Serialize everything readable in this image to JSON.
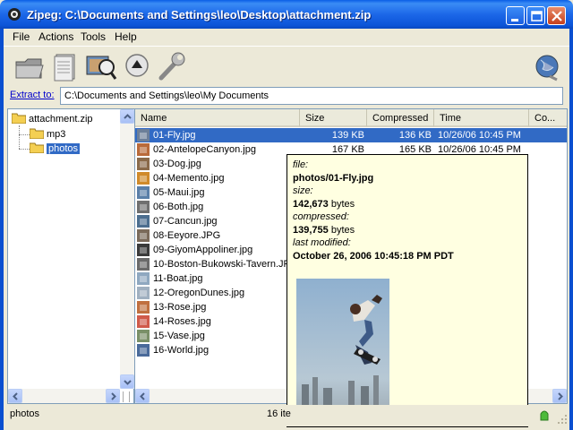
{
  "window": {
    "title": "Zipeg: C:\\Documents and Settings\\leo\\Desktop\\attachment.zip"
  },
  "menu": {
    "file": "File",
    "actions": "Actions",
    "tools": "Tools",
    "help": "Help"
  },
  "toolbar": {
    "icons": [
      "open-folder-icon",
      "document-stack-icon",
      "preview-icon",
      "eject-icon",
      "wrench-icon",
      "world-icon"
    ]
  },
  "extract": {
    "label": "Extract to:",
    "path": "C:\\Documents and Settings\\leo\\My Documents"
  },
  "tree": {
    "root": "attachment.zip",
    "children": [
      "mp3",
      "photos"
    ],
    "selected": "photos"
  },
  "columns": {
    "name": "Name",
    "size": "Size",
    "compressed": "Compressed",
    "time": "Time",
    "comment": "Co..."
  },
  "files": [
    {
      "name": "01-Fly.jpg",
      "size": "139 KB",
      "compressed": "136 KB",
      "time": "10/26/06 10:45 PM",
      "selected": true
    },
    {
      "name": "02-AntelopeCanyon.jpg",
      "size": "167 KB",
      "compressed": "165 KB",
      "time": "10/26/06 10:45 PM"
    },
    {
      "name": "03-Dog.jpg"
    },
    {
      "name": "04-Memento.jpg"
    },
    {
      "name": "05-Maui.jpg"
    },
    {
      "name": "06-Both.jpg"
    },
    {
      "name": "07-Cancun.jpg"
    },
    {
      "name": "08-Eeyore.JPG"
    },
    {
      "name": "09-GiyomAppoliner.jpg"
    },
    {
      "name": "10-Boston-Bukowski-Tavern.JPG"
    },
    {
      "name": "11-Boat.jpg"
    },
    {
      "name": "12-OregonDunes.jpg"
    },
    {
      "name": "13-Rose.jpg"
    },
    {
      "name": "14-Roses.jpg"
    },
    {
      "name": "15-Vase.jpg"
    },
    {
      "name": "16-World.jpg"
    }
  ],
  "tooltip": {
    "file_label": "file:",
    "file_value": "photos/01-Fly.jpg",
    "size_label": "size:",
    "size_number": "142,673",
    "size_unit": " bytes",
    "compressed_label": "compressed:",
    "compressed_number": "139,755",
    "compressed_unit": " bytes",
    "modified_label": "last modified:",
    "modified_value": "October 26, 2006 10:45:18 PM PDT"
  },
  "status": {
    "left": "photos",
    "middle": "16 ite"
  },
  "colors": {
    "titlebar": "#0a5ee6",
    "selection": "#316ac5",
    "tooltip_bg": "#ffffe1",
    "link": "#0000cc"
  }
}
